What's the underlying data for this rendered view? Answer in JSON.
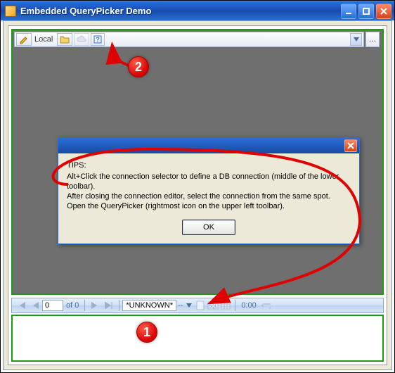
{
  "window": {
    "title": "Embedded QueryPicker Demo"
  },
  "topbar": {
    "mode_label": "Local"
  },
  "tips": {
    "heading": "TIPS:",
    "line1": "Alt+Click the connection selector to define a DB connection (middle of the lower toolbar).",
    "line2": "After closing the connection editor, select the connection from the same spot.",
    "line3": "Open the QueryPicker (rightmost icon on the upper left toolbar).",
    "ok_label": "OK"
  },
  "nav": {
    "pos_value": "0",
    "of_label": "of 0",
    "connection_label": "*UNKNOWN*",
    "connection_suffix": "--",
    "time_label": "0:00"
  },
  "callouts": {
    "top": "2",
    "bottom": "1"
  }
}
